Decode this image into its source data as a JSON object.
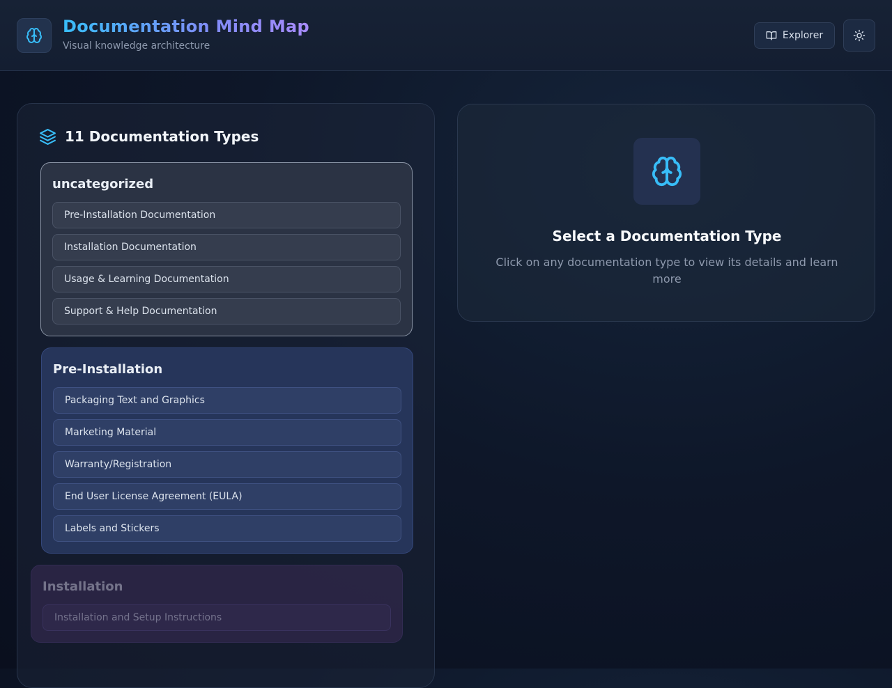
{
  "header": {
    "title": "Documentation Mind Map",
    "subtitle": "Visual knowledge architecture",
    "explorer_label": "Explorer",
    "logo_icon": "brain-icon",
    "explorer_icon": "book-open-icon",
    "theme_icon": "sun-icon"
  },
  "left_panel": {
    "heading": "11 Documentation Types",
    "heading_icon": "layers-icon",
    "groups": [
      {
        "title": "uncategorized",
        "items": [
          "Pre-Installation Documentation",
          "Installation Documentation",
          "Usage & Learning Documentation",
          "Support & Help Documentation"
        ]
      },
      {
        "title": "Pre-Installation",
        "items": [
          "Packaging Text and Graphics",
          "Marketing Material",
          "Warranty/Registration",
          "End User License Agreement (EULA)",
          "Labels and Stickers"
        ]
      },
      {
        "title": "Installation",
        "items": [
          "Installation and Setup Instructions"
        ]
      }
    ]
  },
  "right_panel": {
    "icon": "brain-icon",
    "title": "Select a Documentation Type",
    "description": "Click on any documentation type to view its details and learn more"
  },
  "colors": {
    "accent": "#38bdf8",
    "accent_secondary": "#a78bfa",
    "background": "#0a0f1e"
  }
}
